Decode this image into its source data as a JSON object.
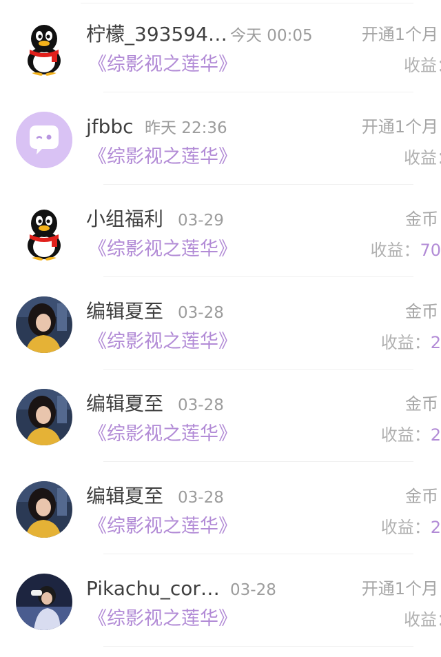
{
  "entries": [
    {
      "name": "柠檬_393594…",
      "time": "今天 00:05",
      "book": "《综影视之莲华》",
      "action": "开通1个月",
      "earn_label": "收益：",
      "earn_value": "",
      "avatar": "penguin-icon"
    },
    {
      "name": "jfbbc",
      "time": "昨天 22:36",
      "book": "《综影视之莲华》",
      "action": "开通1个月",
      "earn_label": "收益：",
      "earn_value": "",
      "avatar": "chat-bubble-icon"
    },
    {
      "name": "小组福利",
      "time": "03-29",
      "book": "《综影视之莲华》",
      "action": "金币",
      "earn_label": "收益：",
      "earn_value": "70",
      "avatar": "penguin-icon"
    },
    {
      "name": "编辑夏至",
      "time": "03-28",
      "book": "《综影视之莲华》",
      "action": "金币",
      "earn_label": "收益：",
      "earn_value": "2",
      "avatar": "user-photo"
    },
    {
      "name": "编辑夏至",
      "time": "03-28",
      "book": "《综影视之莲华》",
      "action": "金币",
      "earn_label": "收益：",
      "earn_value": "2",
      "avatar": "user-photo"
    },
    {
      "name": "编辑夏至",
      "time": "03-28",
      "book": "《综影视之莲华》",
      "action": "金币",
      "earn_label": "收益：",
      "earn_value": "2",
      "avatar": "user-photo"
    },
    {
      "name": "Pikachu_cor…",
      "time": "03-28",
      "book": "《综影视之莲华》",
      "action": "开通1个月",
      "earn_label": "收益：",
      "earn_value": "",
      "avatar": "user-photo"
    }
  ],
  "colors": {
    "accent": "#b28bd6",
    "avatar_bubble_bg": "#d9c2f4"
  }
}
